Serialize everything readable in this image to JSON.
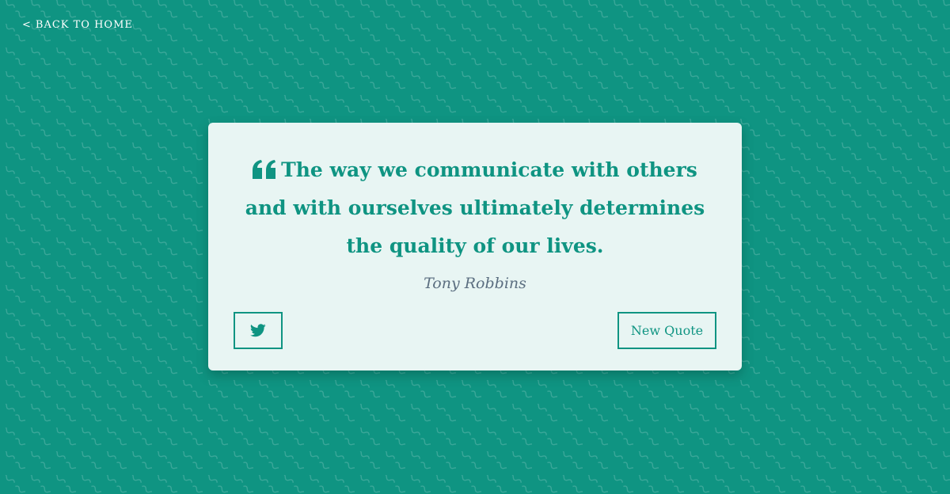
{
  "nav": {
    "back_chevron": "<",
    "back_label": "BACK TO HOME"
  },
  "quote_card": {
    "quote_icon": "quote-left-icon",
    "quote_text": "The way we communicate with others and with ourselves ultimately determines the quality of our lives.",
    "author": "Tony Robbins",
    "tweet_icon": "twitter-icon",
    "new_quote_label": "New Quote"
  },
  "colors": {
    "background": "#0f9482",
    "card": "#e8f5f3",
    "accent": "#0f9482",
    "author_text": "#5b6e80",
    "link_text": "#ffffff"
  }
}
